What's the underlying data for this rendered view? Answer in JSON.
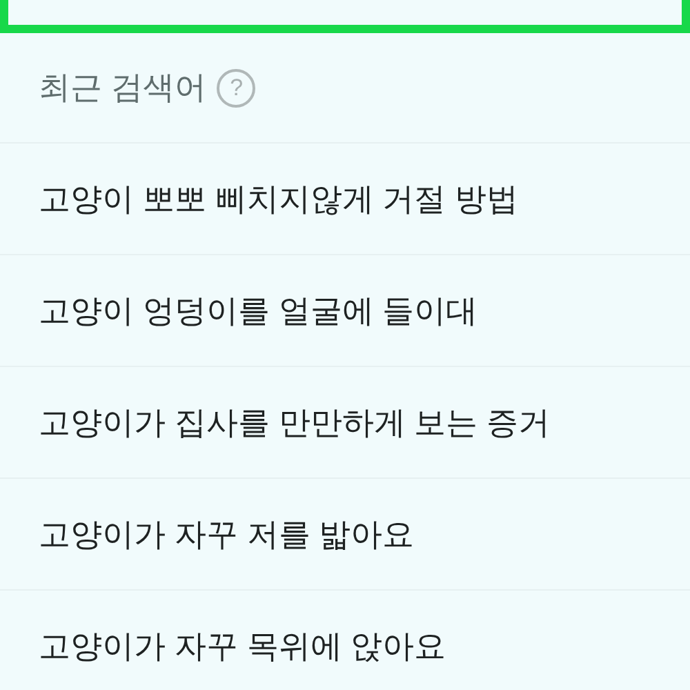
{
  "recent_searches": {
    "title": "최근 검색어",
    "help_icon": "?",
    "items": [
      {
        "text": "고양이 뽀뽀 삐치지않게 거절 방법"
      },
      {
        "text": "고양이 엉덩이를 얼굴에 들이대"
      },
      {
        "text": "고양이가 집사를 만만하게 보는 증거"
      },
      {
        "text": "고양이가 자꾸 저를 밟아요"
      },
      {
        "text": "고양이가 자꾸 목위에 앉아요"
      }
    ]
  }
}
